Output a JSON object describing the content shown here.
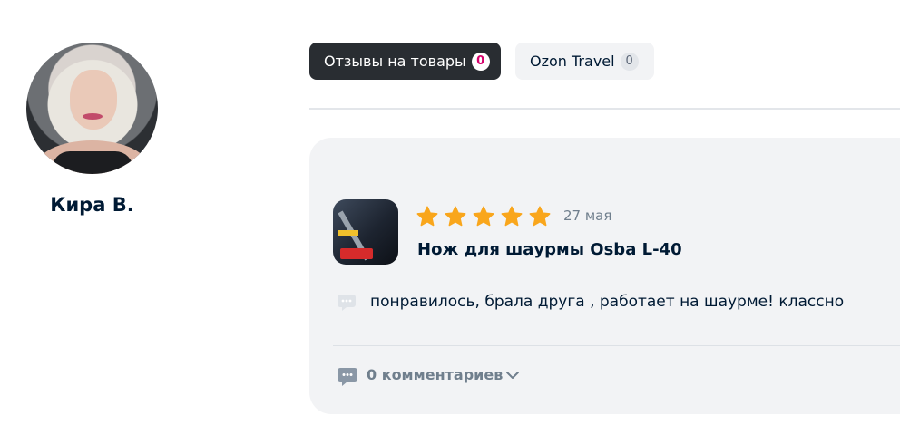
{
  "user": {
    "name": "Кира В."
  },
  "tabs": [
    {
      "label": "Отзывы на товары",
      "count": "0"
    },
    {
      "label": "Ozon Travel",
      "count": "0"
    }
  ],
  "review": {
    "rating": 5,
    "date": "27 мая",
    "product_title": "Нож для шаурмы Osba L-40",
    "text": "понравилось, брала друга , работает на шаурме! классно",
    "comments_label": "0 комментариев"
  },
  "colors": {
    "star": "#f9a61c",
    "active_tab": "#292d32",
    "badge_accent": "#d6006b",
    "card_bg": "#f2f3f5"
  },
  "icons": [
    "star-icon",
    "comment-bubble-icon",
    "chevron-down-icon"
  ]
}
